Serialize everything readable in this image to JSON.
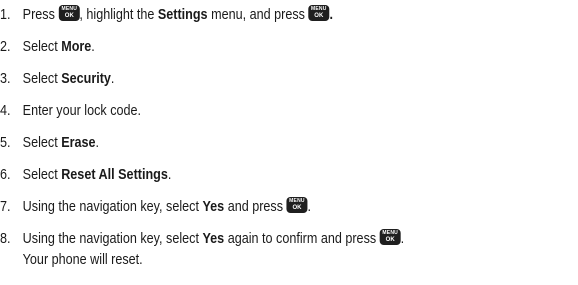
{
  "key_icon": {
    "line1": "MENU",
    "line2": "OK"
  },
  "steps": [
    {
      "num": "1.",
      "a": "Press ",
      "b": ", highlight the ",
      "c": "Settings",
      "d": " menu, and press ",
      "e": "."
    },
    {
      "num": "2.",
      "a": "Select ",
      "b": "More",
      "c": "."
    },
    {
      "num": "3.",
      "a": "Select ",
      "b": "Security",
      "c": "."
    },
    {
      "num": "4.",
      "a": "Enter your lock code."
    },
    {
      "num": "5.",
      "a": "Select ",
      "b": "Erase",
      "c": "."
    },
    {
      "num": "6.",
      "a": "Select ",
      "b": "Reset All Settings",
      "c": "."
    },
    {
      "num": "7.",
      "a": "Using the navigation key, select ",
      "b": "Yes",
      "c": " and press ",
      "d": "."
    },
    {
      "num": "8.",
      "a": "Using the navigation key, select ",
      "b": "Yes",
      "c": " again to confirm and press ",
      "d": ".",
      "e": "Your phone will reset."
    }
  ]
}
